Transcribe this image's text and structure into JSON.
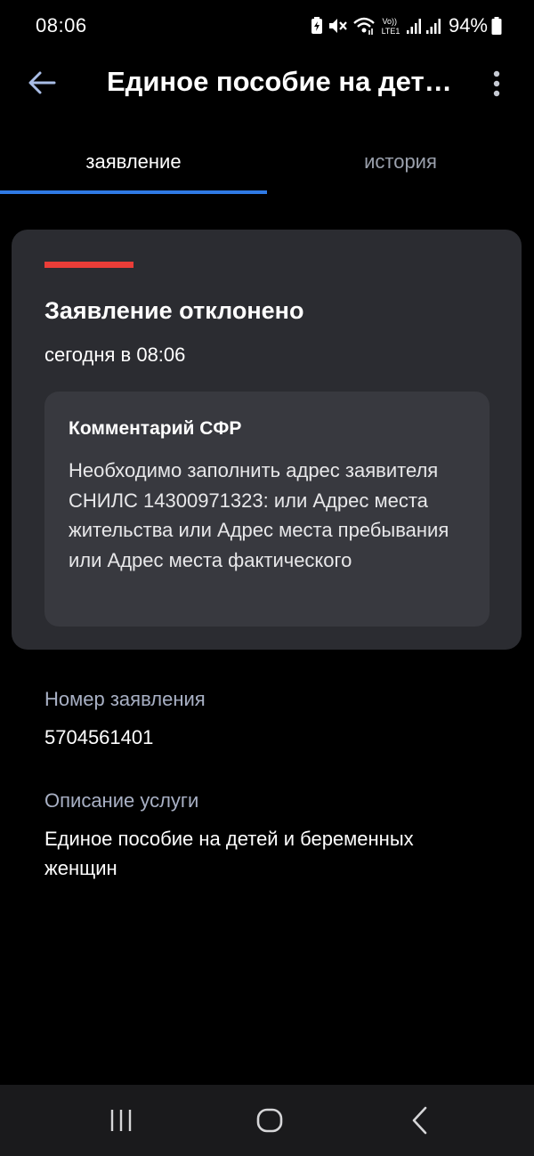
{
  "status_bar": {
    "time": "08:06",
    "battery": "94%",
    "volte_label": "Vo)) LTE1",
    "icons": [
      "battery-saver-icon",
      "mute-icon",
      "wifi-icon",
      "volte-icon",
      "signal-icon",
      "signal-icon",
      "battery-icon"
    ]
  },
  "app_bar": {
    "title": "Единое пособие на детей и беременных женщин",
    "back_icon": "arrow-left-icon",
    "more_icon": "more-vertical-icon"
  },
  "tabs": {
    "items": [
      {
        "label": "заявление",
        "selected": true
      },
      {
        "label": "история",
        "selected": false
      }
    ],
    "accent_color": "#2f7ae5"
  },
  "status_card": {
    "title": "Заявление отклонено",
    "date": "сегодня в 08:06",
    "accent_color": "#ea3d38",
    "comment": {
      "label": "Комментарий СФР",
      "text": "Необходимо заполнить адрес заявителя СНИЛС 14300971323: или Адрес места жительства или Адрес места пребывания или Адрес места фактического"
    }
  },
  "details": {
    "application_number_label": "Номер заявления",
    "application_number": "5704561401",
    "service_description_label": "Описание услуги",
    "service_description": "Единое пособие на детей и беременных женщин"
  },
  "nav_bar": {
    "icons": [
      "recent-apps-icon",
      "home-icon",
      "back-icon"
    ]
  }
}
